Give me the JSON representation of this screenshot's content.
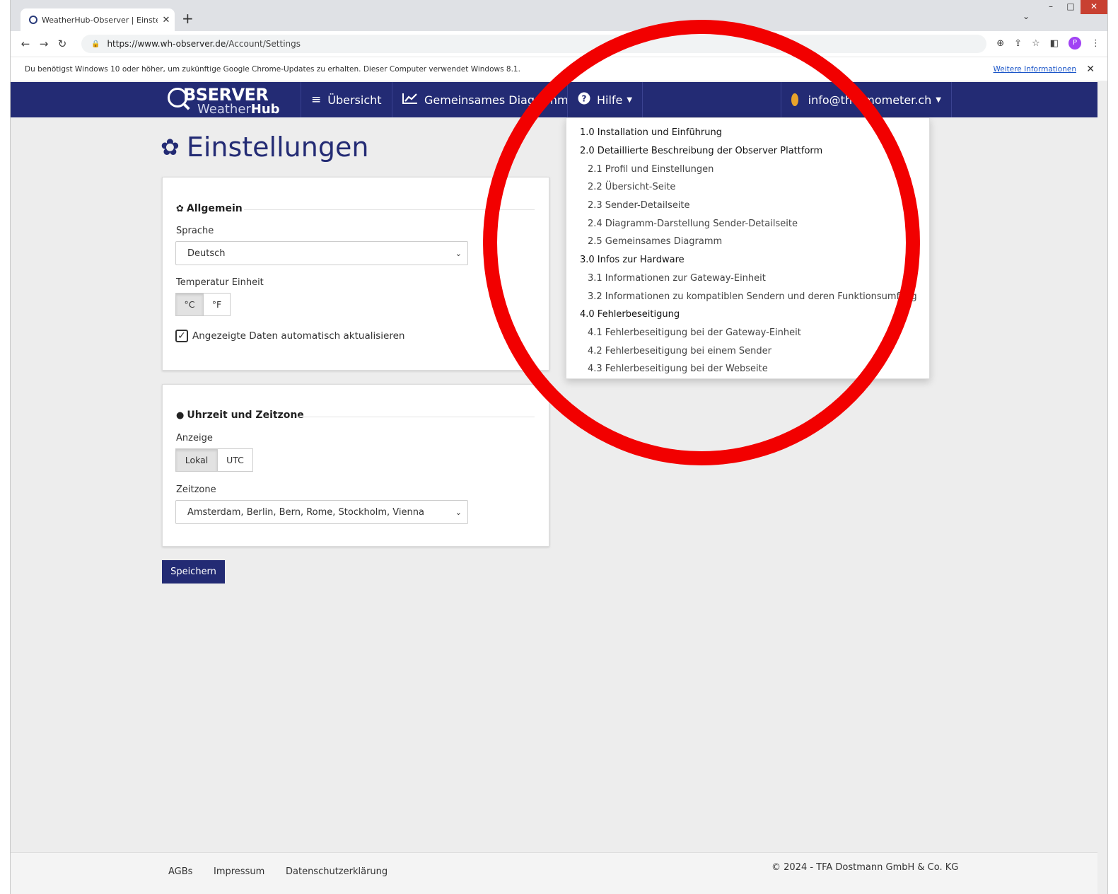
{
  "browser": {
    "tab_title": "WeatherHub-Observer | Einstellu",
    "tab_close": "✕",
    "new_tab": "+",
    "url": "https://www.wh-observer.de/Account/Settings",
    "url_host": "https://www.wh-observer.de",
    "url_path": "/Account/Settings",
    "profile_initial": "P",
    "window_buttons": [
      "–",
      "□",
      "✕"
    ],
    "infobar_text": "Du benötigst Windows 10 oder höher, um zukünftige Google Chrome-Updates zu erhalten. Dieser Computer verwendet Windows 8.1.",
    "infobar_link": "Weitere Informationen",
    "infobar_close": "✕"
  },
  "navbar": {
    "logo_top": "BSERVER",
    "logo_bottom_light": "Weather",
    "logo_bottom_bold": "Hub",
    "overview": "Übersicht",
    "diagram": "Gemeinsames Diagramm",
    "help": "Hilfe",
    "user": "info@thermometer.ch",
    "colors": {
      "bar": "#232b74",
      "accent": "#e9a42b"
    },
    "icons": {
      "overview": "bars-icon",
      "diagram": "line-chart-icon",
      "help": "question-circle-icon",
      "user": "user-circle-icon"
    }
  },
  "page": {
    "title": "Einstellungen",
    "title_icon": "gear-icon",
    "general": {
      "legend": "Allgemein",
      "language_label": "Sprache",
      "language_value": "Deutsch",
      "temp_label": "Temperatur Einheit",
      "temp_options": [
        "°C",
        "°F"
      ],
      "temp_selected": "°C",
      "auto_refresh_label": "Angezeigte Daten automatisch aktualisieren",
      "auto_refresh_checked": true
    },
    "time": {
      "legend": "Uhrzeit und Zeitzone",
      "display_label": "Anzeige",
      "display_options": [
        "Lokal",
        "UTC"
      ],
      "display_selected": "Lokal",
      "timezone_label": "Zeitzone",
      "timezone_value": "Amsterdam, Berlin, Bern, Rome, Stockholm, Vienna"
    },
    "save": "Speichern"
  },
  "help_menu": [
    {
      "text": "1.0 Installation und Einführung",
      "level": 1
    },
    {
      "text": "2.0 Detaillierte Beschreibung der Observer Plattform",
      "level": 1
    },
    {
      "text": "2.1 Profil und Einstellungen",
      "level": 2
    },
    {
      "text": "2.2 Übersicht-Seite",
      "level": 2
    },
    {
      "text": "2.3 Sender-Detailseite",
      "level": 2
    },
    {
      "text": "2.4 Diagramm-Darstellung Sender-Detailseite",
      "level": 2
    },
    {
      "text": "2.5 Gemeinsames Diagramm",
      "level": 2
    },
    {
      "text": "3.0 Infos zur Hardware",
      "level": 1
    },
    {
      "text": "3.1 Informationen zur Gateway-Einheit",
      "level": 2
    },
    {
      "text": "3.2 Informationen zu kompatiblen Sendern und deren Funktionsumfang",
      "level": 2
    },
    {
      "text": "4.0 Fehlerbeseitigung",
      "level": 1
    },
    {
      "text": "4.1 Fehlerbeseitigung bei der Gateway-Einheit",
      "level": 2
    },
    {
      "text": "4.2 Fehlerbeseitigung bei einem Sender",
      "level": 2
    },
    {
      "text": "4.3 Fehlerbeseitigung bei der Webseite",
      "level": 2
    }
  ],
  "footer": {
    "agb": "AGBs",
    "impressum": "Impressum",
    "privacy": "Datenschutzerklärung",
    "copyright": "© 2024 - TFA Dostmann GmbH & Co. KG"
  }
}
